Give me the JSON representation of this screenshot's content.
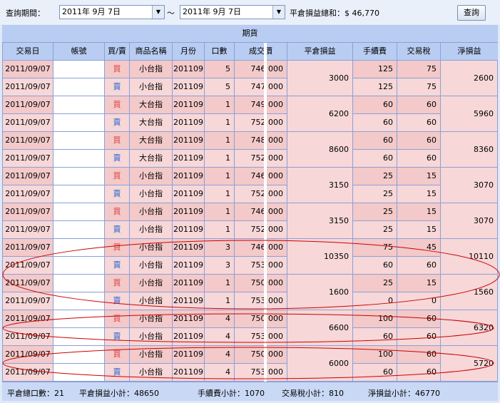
{
  "query": {
    "label": "查詢期間：",
    "start": "2011年  9月  7日",
    "sep": "～",
    "end": "2011年  9月  7日",
    "total_label": "平倉損益總和：$ 46,770",
    "button": "查詢"
  },
  "table": {
    "group_title": "期貨",
    "headers": [
      "交易日",
      "帳號",
      "買/賣",
      "商品名稱",
      "月份",
      "口數",
      "成交價",
      "平倉損益",
      "手續費",
      "交易稅",
      "淨損益"
    ],
    "rows": [
      {
        "date": "2011/09/07",
        "side": "買",
        "product": "小台指",
        "month": "201109",
        "qty": "5",
        "price": "746 000",
        "fee": "125",
        "tax": "75"
      },
      {
        "date": "2011/09/07",
        "side": "賣",
        "product": "小台指",
        "month": "201109",
        "qty": "5",
        "price": "747 000",
        "fee": "125",
        "tax": "75"
      },
      {
        "date": "2011/09/07",
        "side": "買",
        "product": "大台指",
        "month": "201109",
        "qty": "1",
        "price": "749 000",
        "fee": "60",
        "tax": "60"
      },
      {
        "date": "2011/09/07",
        "side": "賣",
        "product": "大台指",
        "month": "201109",
        "qty": "1",
        "price": "752 000",
        "fee": "60",
        "tax": "60"
      },
      {
        "date": "2011/09/07",
        "side": "買",
        "product": "大台指",
        "month": "201109",
        "qty": "1",
        "price": "748 000",
        "fee": "60",
        "tax": "60"
      },
      {
        "date": "2011/09/07",
        "side": "賣",
        "product": "大台指",
        "month": "201109",
        "qty": "1",
        "price": "752 000",
        "fee": "60",
        "tax": "60"
      },
      {
        "date": "2011/09/07",
        "side": "買",
        "product": "小台指",
        "month": "201109",
        "qty": "1",
        "price": "746 000",
        "fee": "25",
        "tax": "15"
      },
      {
        "date": "2011/09/07",
        "side": "賣",
        "product": "小台指",
        "month": "201109",
        "qty": "1",
        "price": "752 000",
        "fee": "25",
        "tax": "15"
      },
      {
        "date": "2011/09/07",
        "side": "買",
        "product": "小台指",
        "month": "201109",
        "qty": "1",
        "price": "746 000",
        "fee": "25",
        "tax": "15"
      },
      {
        "date": "2011/09/07",
        "side": "賣",
        "product": "小台指",
        "month": "201109",
        "qty": "1",
        "price": "752 000",
        "fee": "25",
        "tax": "15"
      },
      {
        "date": "2011/09/07",
        "side": "買",
        "product": "小台指",
        "month": "201109",
        "qty": "3",
        "price": "746 000",
        "fee": "75",
        "tax": "45"
      },
      {
        "date": "2011/09/07",
        "side": "賣",
        "product": "小台指",
        "month": "201109",
        "qty": "3",
        "price": "753 000",
        "fee": "60",
        "tax": "60"
      },
      {
        "date": "2011/09/07",
        "side": "買",
        "product": "小台指",
        "month": "201109",
        "qty": "1",
        "price": "750 000",
        "fee": "25",
        "tax": "15"
      },
      {
        "date": "2011/09/07",
        "side": "賣",
        "product": "小台指",
        "month": "201109",
        "qty": "1",
        "price": "753 000",
        "fee": "0",
        "tax": "0"
      },
      {
        "date": "2011/09/07",
        "side": "買",
        "product": "小台指",
        "month": "201109",
        "qty": "4",
        "price": "750 000",
        "fee": "100",
        "tax": "60"
      },
      {
        "date": "2011/09/07",
        "side": "賣",
        "product": "小台指",
        "month": "201109",
        "qty": "4",
        "price": "753 000",
        "fee": "60",
        "tax": "60"
      },
      {
        "date": "2011/09/07",
        "side": "買",
        "product": "小台指",
        "month": "201109",
        "qty": "4",
        "price": "750 000",
        "fee": "100",
        "tax": "60"
      },
      {
        "date": "2011/09/07",
        "side": "賣",
        "product": "小台指",
        "month": "201109",
        "qty": "4",
        "price": "753 000",
        "fee": "60",
        "tax": "60"
      }
    ],
    "pairs": [
      {
        "pnl": "3000",
        "net": "2600"
      },
      {
        "pnl": "6200",
        "net": "5960"
      },
      {
        "pnl": "8600",
        "net": "8360"
      },
      {
        "pnl": "3150",
        "net": "3070"
      },
      {
        "pnl": "3150",
        "net": "3070"
      },
      {
        "pnl": "10350",
        "net": "10110"
      },
      {
        "pnl": "1600",
        "net": "1560"
      },
      {
        "pnl": "6600",
        "net": "6320"
      },
      {
        "pnl": "6000",
        "net": "5720"
      }
    ]
  },
  "footer": {
    "qty": "平倉總口數：21",
    "pnl": "平倉損益小計：48650",
    "fee": "手續費小計：1070",
    "tax": "交易稅小計：810",
    "net": "淨損益小計：46770"
  },
  "colors": {
    "header": "#b9cdf2",
    "row": "#f7d7d7",
    "rowAlt": "#f3c9c9",
    "buy": "#e04040",
    "sell": "#2a6bd0",
    "ellipse": "#cc0000"
  }
}
